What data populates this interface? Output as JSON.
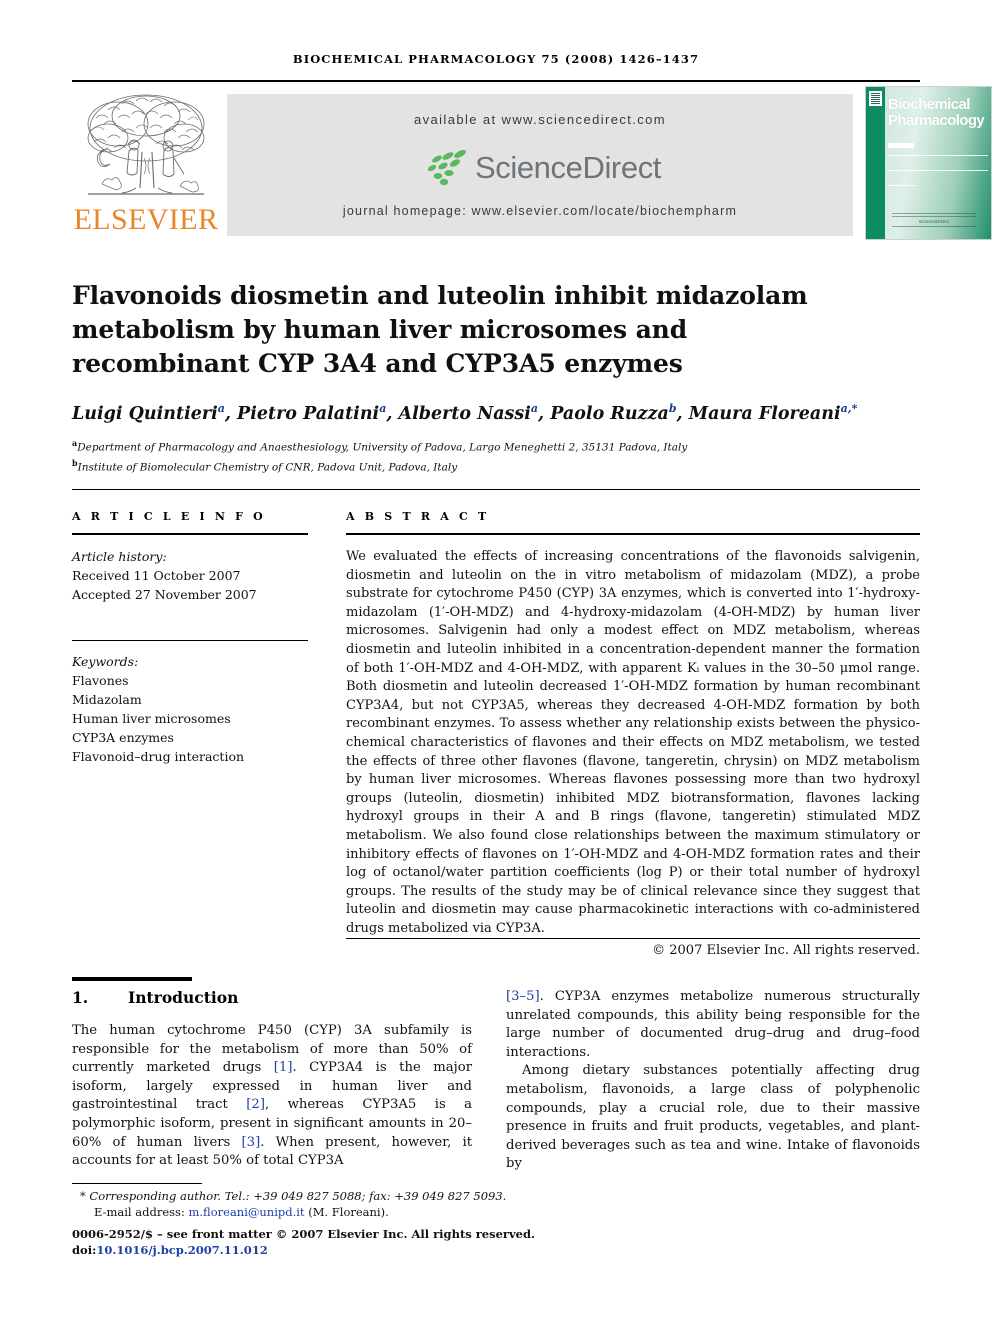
{
  "running_head": "BIOCHEMICAL PHARMACOLOGY 75 (2008) 1426–1437",
  "masthead": {
    "publisher_name": "ELSEVIER",
    "available_at": "available at www.sciencedirect.com",
    "sciencedirect_word": "ScienceDirect",
    "journal_homepage": "journal homepage: www.elsevier.com/locate/biochempharm",
    "cover_title_line1": "Biochemical",
    "cover_title_line2": "Pharmacology",
    "cover_footer_sd": "ScienceDirect"
  },
  "article": {
    "title": "Flavonoids diosmetin and luteolin inhibit midazolam metabolism by human liver microsomes and recombinant CYP 3A4 and CYP3A5 enzymes",
    "authors_html": "Luigi Quintieri<sup>a</sup>, Pietro Palatini<sup>a</sup>, Alberto Nassi<sup>a</sup>, Paolo Ruzza<sup>b</sup>, Maura Floreani<sup>a,*</sup>",
    "affiliation_a": "Department of Pharmacology and Anaesthesiology, University of Padova, Largo Meneghetti 2, 35131 Padova, Italy",
    "affiliation_b": "Institute of Biomolecular Chemistry of CNR, Padova Unit, Padova, Italy"
  },
  "article_info": {
    "heading": "A R T I C L E   I N F O",
    "history_label": "Article history:",
    "received": "Received 11 October 2007",
    "accepted": "Accepted 27 November 2007",
    "keywords_label": "Keywords:",
    "keywords": [
      "Flavones",
      "Midazolam",
      "Human liver microsomes",
      "CYP3A enzymes",
      "Flavonoid–drug interaction"
    ]
  },
  "abstract": {
    "heading": "A B S T R A C T",
    "body": "We evaluated the effects of increasing concentrations of the flavonoids salvigenin, diosmetin and luteolin on the in vitro metabolism of midazolam (MDZ), a probe substrate for cytochrome P450 (CYP) 3A enzymes, which is converted into 1′-hydroxy-midazolam (1′-OH-MDZ) and 4-hydroxy-midazolam (4-OH-MDZ) by human liver microsomes. Salvigenin had only a modest effect on MDZ metabolism, whereas diosmetin and luteolin inhibited in a concentration-dependent manner the formation of both 1′-OH-MDZ and 4-OH-MDZ, with apparent Kᵢ values in the 30–50 μmol range. Both diosmetin and luteolin decreased 1′-OH-MDZ formation by human recombinant CYP3A4, but not CYP3A5, whereas they decreased 4-OH-MDZ formation by both recombinant enzymes. To assess whether any relationship exists between the physico-chemical characteristics of flavones and their effects on MDZ metabolism, we tested the effects of three other flavones (flavone, tangeretin, chrysin) on MDZ metabolism by human liver microsomes. Whereas flavones possessing more than two hydroxyl groups (luteolin, diosmetin) inhibited MDZ biotransformation, flavones lacking hydroxyl groups in their A and B rings (flavone, tangeretin) stimulated MDZ metabolism. We also found close relationships between the maximum stimulatory or inhibitory effects of flavones on 1′-OH-MDZ and 4-OH-MDZ formation rates and their log of octanol/water partition coefficients (log P) or their total number of hydroxyl groups. The results of the study may be of clinical relevance since they suggest that luteolin and diosmetin may cause pharmacokinetic interactions with co-administered drugs metabolized via CYP3A.",
    "copyright": "© 2007 Elsevier Inc. All rights reserved."
  },
  "introduction": {
    "number": "1.",
    "heading": "Introduction",
    "left_paragraph_html": "The human cytochrome P450 (CYP) 3A subfamily is responsible for the metabolism of more than 50% of currently marketed drugs <span class=\"ref\">[1]</span>. CYP3A4 is the major isoform, largely expressed in human liver and gastrointestinal tract <span class=\"ref\">[2]</span>, whereas CYP3A5 is a polymorphic isoform, present in significant amounts in 20–60% of human livers <span class=\"ref\">[3]</span>. When present, however, it accounts for at least 50% of total CYP3A",
    "right_paragraph1_html": "<span class=\"ref\">[3–5]</span>. CYP3A enzymes metabolize numerous structurally unrelated compounds, this ability being responsible for the large number of documented drug–drug and drug–food interactions.",
    "right_paragraph2_html": "Among dietary substances potentially affecting drug metabolism, flavonoids, a large class of polyphenolic compounds, play a crucial role, due to their massive presence in fruits and fruit products, vegetables, and plant-derived beverages such as tea and wine. Intake of flavonoids by"
  },
  "footnotes": {
    "corresponding_html": "<span style=\"font-style:normal\">*</span> Corresponding author. Tel.: +39 049 827 5088; fax: +39 049 827 5093.",
    "email_html": "E-mail address: <span class=\"link\">m.floreani@unipd.it</span> (M. Floreani).",
    "front_matter": "0006-2952/$ – see front matter © 2007 Elsevier Inc. All rights reserved.",
    "doi_prefix": "doi:",
    "doi_value": "10.1016/j.bcp.2007.11.012"
  },
  "colors": {
    "elsevier_orange": "#e8862a",
    "sciencedirect_green": "#5cb85c",
    "sciencedirect_gray": "#6e7477",
    "link_blue": "#1f3fa8",
    "cover_green": "#1f8f6a",
    "banner_gray": "#e3e3e3"
  }
}
